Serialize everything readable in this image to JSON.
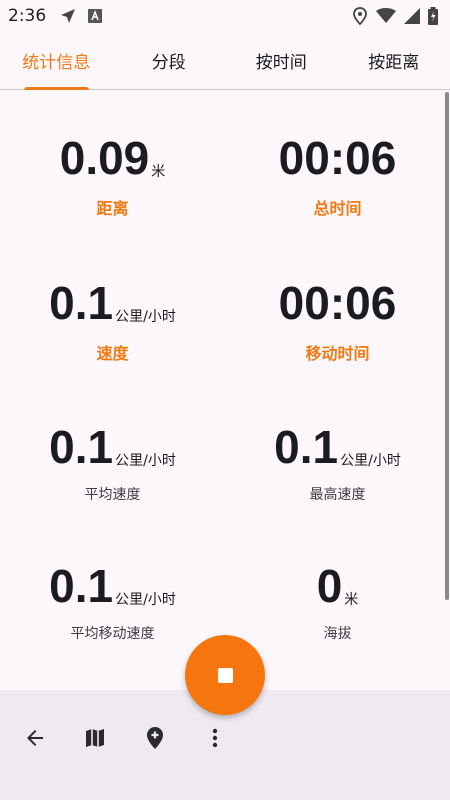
{
  "status_bar": {
    "time": "2:36",
    "left_icons": [
      "navigation-arrow-icon",
      "font-a-icon"
    ],
    "right_icons": [
      "location-pin-icon",
      "wifi-icon",
      "signal-icon",
      "battery-charging-icon"
    ]
  },
  "tabs": [
    {
      "label": "统计信息",
      "active": true
    },
    {
      "label": "分段",
      "active": false
    },
    {
      "label": "按时间",
      "active": false
    },
    {
      "label": "按距离",
      "active": false
    }
  ],
  "stats": {
    "distance": {
      "value": "0.09",
      "unit": "米",
      "label": "距离"
    },
    "total_time": {
      "value": "00:06",
      "unit": "",
      "label": "总时间"
    },
    "speed": {
      "value": "0.1",
      "unit": "公里/小时",
      "label": "速度"
    },
    "moving_time": {
      "value": "00:06",
      "unit": "",
      "label": "移动时间"
    },
    "avg_speed": {
      "value": "0.1",
      "unit": "公里/小时",
      "label": "平均速度"
    },
    "max_speed": {
      "value": "0.1",
      "unit": "公里/小时",
      "label": "最高速度"
    },
    "avg_moving_speed": {
      "value": "0.1",
      "unit": "公里/小时",
      "label": "平均移动速度"
    },
    "elevation": {
      "value": "0",
      "unit": "米",
      "label": "海拔"
    }
  },
  "bottom_bar": {
    "icons": [
      "back-arrow-icon",
      "map-icon",
      "add-marker-icon",
      "more-vert-icon"
    ]
  },
  "fab": {
    "icon": "stop-icon"
  },
  "colors": {
    "accent": "#f07a14",
    "fab": "#f5750f",
    "background": "#fcf7fb",
    "bottom_bar": "#eeeaf0"
  }
}
